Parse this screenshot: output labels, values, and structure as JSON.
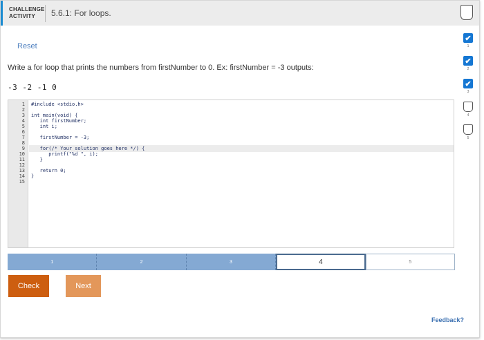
{
  "header": {
    "badge_line1": "CHALLENGE",
    "badge_line2": "ACTIVITY",
    "title": "5.6.1: For loops."
  },
  "reset_label": "Reset",
  "prompt": "Write a for loop that prints the numbers from firstNumber to 0. Ex: firstNumber = -3 outputs:",
  "sample_output": "-3 -2 -1 0",
  "editor": {
    "line_numbers": [
      "1",
      "2",
      "3",
      "4",
      "5",
      "6",
      "7",
      "8",
      "9",
      "10",
      "11",
      "12",
      "13",
      "14",
      "15"
    ],
    "lines": [
      "#include <stdio.h>",
      "",
      "int main(void) {",
      "   int firstNumber;",
      "   int i;",
      "",
      "   firstNumber = -3;",
      "",
      "   for(/* Your solution goes here */) {",
      "      printf(\"%d \", i);",
      "   }",
      "",
      "   return 0;",
      "}",
      ""
    ],
    "active_line": 9
  },
  "progress": {
    "steps": [
      "1",
      "2",
      "3",
      "4",
      "5"
    ],
    "completed": 3,
    "current": 4
  },
  "buttons": {
    "check": "Check",
    "next": "Next"
  },
  "feedback_label": "Feedback?",
  "side_levels": [
    {
      "num": "1",
      "done": true
    },
    {
      "num": "2",
      "done": true
    },
    {
      "num": "3",
      "done": true
    },
    {
      "num": "4",
      "done": false
    },
    {
      "num": "5",
      "done": false
    }
  ],
  "colors": {
    "accent": "#1a8bd1",
    "check_button": "#cd5e10",
    "next_button": "#e3975a",
    "progress_done": "#84a9d3",
    "level_done": "#1577d3"
  },
  "icons": {
    "check": "check-icon"
  }
}
